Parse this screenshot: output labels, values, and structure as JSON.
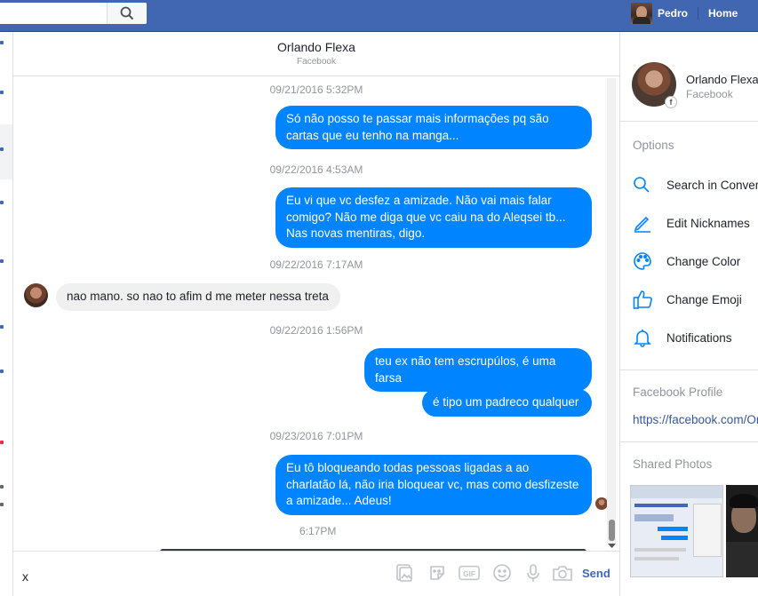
{
  "topbar": {
    "user_name": "Pedro",
    "home_label": "Home",
    "search_value": ""
  },
  "conversation": {
    "title": "Orlando Flexa",
    "subtitle": "Facebook"
  },
  "messages": [
    {
      "type": "timestamp",
      "text": "09/21/2016 5:32PM"
    },
    {
      "type": "out",
      "text": "Só não posso te passar mais informações pq são cartas que eu tenho na manga..."
    },
    {
      "type": "timestamp",
      "text": "09/22/2016 4:53AM"
    },
    {
      "type": "out",
      "text": "Eu vi que vc desfez a amizade. Não vai mais falar comigo? Não me diga que vc caiu na do Aleqsei tb... Nas novas mentiras, digo."
    },
    {
      "type": "timestamp",
      "text": "09/22/2016 7:17AM"
    },
    {
      "type": "in",
      "text": "nao mano.  so nao to afim d me meter nessa treta"
    },
    {
      "type": "timestamp",
      "text": "09/22/2016 1:56PM"
    },
    {
      "type": "out",
      "text": "teu ex não tem escrupúlos, é uma farsa"
    },
    {
      "type": "out",
      "text": "é tipo um padreco qualquer"
    },
    {
      "type": "timestamp",
      "text": "09/23/2016 7:01PM"
    },
    {
      "type": "out",
      "text": "Eu tô bloqueando todas pessoas ligadas a ao charlatão lá, não iria bloquear vc, mas como desfizeste a amizade... Adeus!"
    },
    {
      "type": "timestamp",
      "text": "6:17PM"
    }
  ],
  "composer": {
    "input_value": "x",
    "send_label": "Send"
  },
  "sidebar": {
    "profile_name": "Orlando Flexa",
    "profile_source": "Facebook",
    "options_label": "Options",
    "options": [
      {
        "label": "Search in Conversation",
        "icon": "search-icon"
      },
      {
        "label": "Edit Nicknames",
        "icon": "pencil-icon"
      },
      {
        "label": "Change Color",
        "icon": "palette-icon"
      },
      {
        "label": "Change Emoji",
        "icon": "thumbs-up-icon"
      },
      {
        "label": "Notifications",
        "icon": "bell-icon"
      }
    ],
    "facebook_profile_label": "Facebook Profile",
    "facebook_profile_link": "https://facebook.com/Orlando",
    "shared_photos_label": "Shared Photos"
  },
  "colors": {
    "topbar": "#4267b2",
    "outgoing_bubble": "#0084ff",
    "incoming_bubble": "#f1f0f0",
    "link": "#365899"
  }
}
